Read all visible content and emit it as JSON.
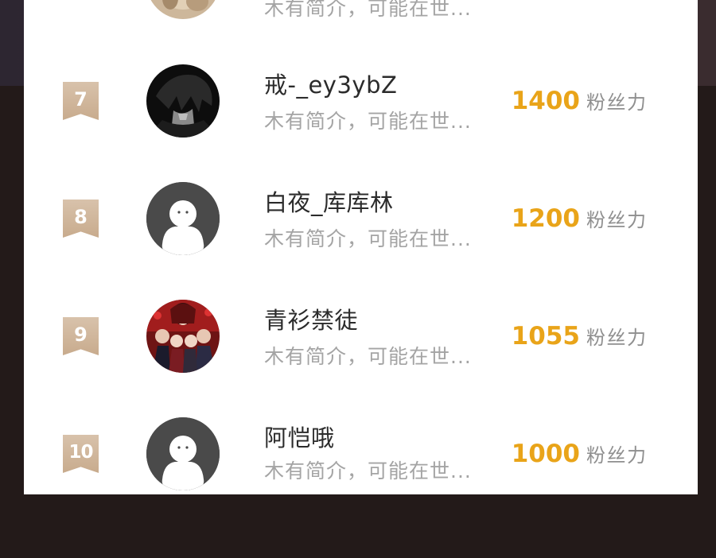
{
  "ranking": {
    "partial_top_row": {
      "bio": "木有简介，可能在世..."
    },
    "rows": [
      {
        "rank": "7",
        "avatar": "dark-anime-avatar",
        "name": "戒-_ey3ybZ",
        "bio": "木有简介，可能在世...",
        "fans": "1400",
        "unit": "粉丝力"
      },
      {
        "rank": "8",
        "avatar": "default-avatar",
        "name": "白夜_库库林",
        "bio": "木有简介，可能在世...",
        "fans": "1200",
        "unit": "粉丝力"
      },
      {
        "rank": "9",
        "avatar": "anime-group-avatar",
        "name": "青衫禁徒",
        "bio": "木有简介，可能在世...",
        "fans": "1055",
        "unit": "粉丝力"
      },
      {
        "rank": "10",
        "avatar": "default-avatar",
        "name": "阿恺哦",
        "bio": "木有简介，可能在世...",
        "fans": "1000",
        "unit": "粉丝力"
      }
    ]
  },
  "colors": {
    "accent": "#e9a419",
    "badge": "#cfb596",
    "backdrop": "#231a19"
  }
}
